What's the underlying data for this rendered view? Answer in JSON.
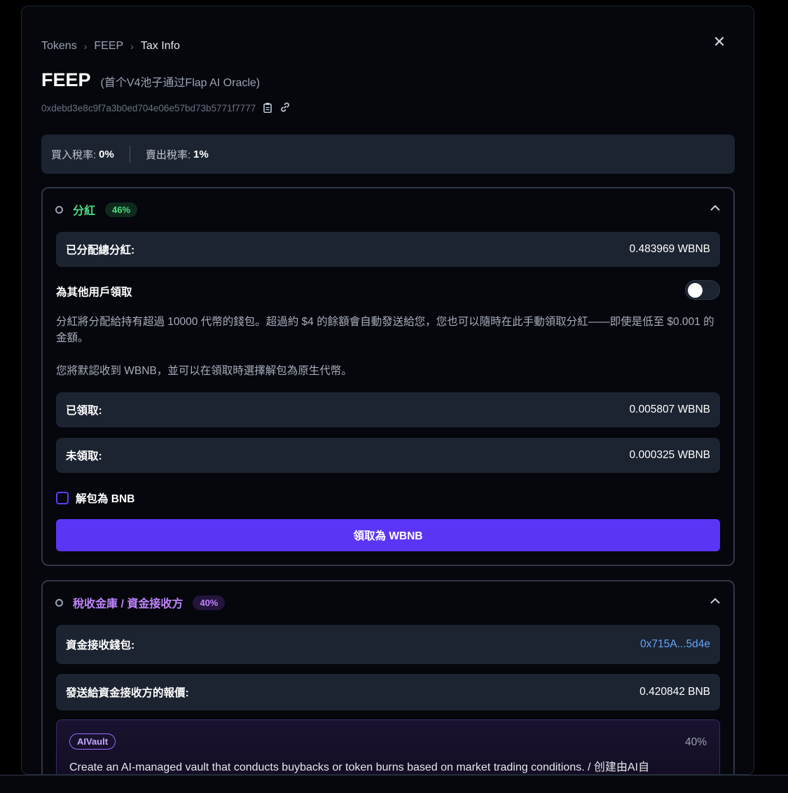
{
  "breadcrumb": {
    "items": [
      "Tokens",
      "FEEP"
    ],
    "current": "Tax Info"
  },
  "token": {
    "symbol": "FEEP",
    "name": "(首个V4池子通过Flap AI Oracle)",
    "address": "0xdebd3e8c9f7a3b0ed704e06e57bd73b5771f7777"
  },
  "icons": {
    "copy": "clipboard-icon",
    "link": "link-icon",
    "close": "close-icon"
  },
  "tax": {
    "buy_label": "買入稅率:",
    "buy_value": "0%",
    "sell_label": "賣出稅率:",
    "sell_value": "1%"
  },
  "dividend": {
    "title": "分紅",
    "badge": "46%",
    "title_color": "#4ade80",
    "total_label": "已分配總分紅:",
    "total_value": "0.483969 WBNB",
    "toggle_label": "為其他用戶領取",
    "desc1": "分紅將分配給持有超過 10000 代幣的錢包。超過約 $4 的餘額會自動發送給您，您也可以隨時在此手動領取分紅——即使是低至 $0.001 的金額。",
    "desc2": "您將默認收到 WBNB，並可以在領取時選擇解包為原生代幣。",
    "claimed_label": "已領取:",
    "claimed_value": "0.005807 WBNB",
    "unclaimed_label": "未領取:",
    "unclaimed_value": "0.000325 WBNB",
    "unwrap_label": "解包為 BNB",
    "claim_button": "領取為 WBNB"
  },
  "treasury": {
    "title": "稅收金庫 / 資金接收方",
    "badge": "40%",
    "title_color": "#c084fc",
    "wallet_label": "資金接收錢包:",
    "wallet_value": "0x715A...5d4e",
    "sent_label": "發送給資金接收方的報價:",
    "sent_value": "0.420842 BNB",
    "vault": {
      "tag": "AIVault",
      "pct": "40%",
      "desc": "Create an AI-managed vault that conducts buybacks or token burns based on market trading conditions. / 创建由AI自"
    }
  }
}
